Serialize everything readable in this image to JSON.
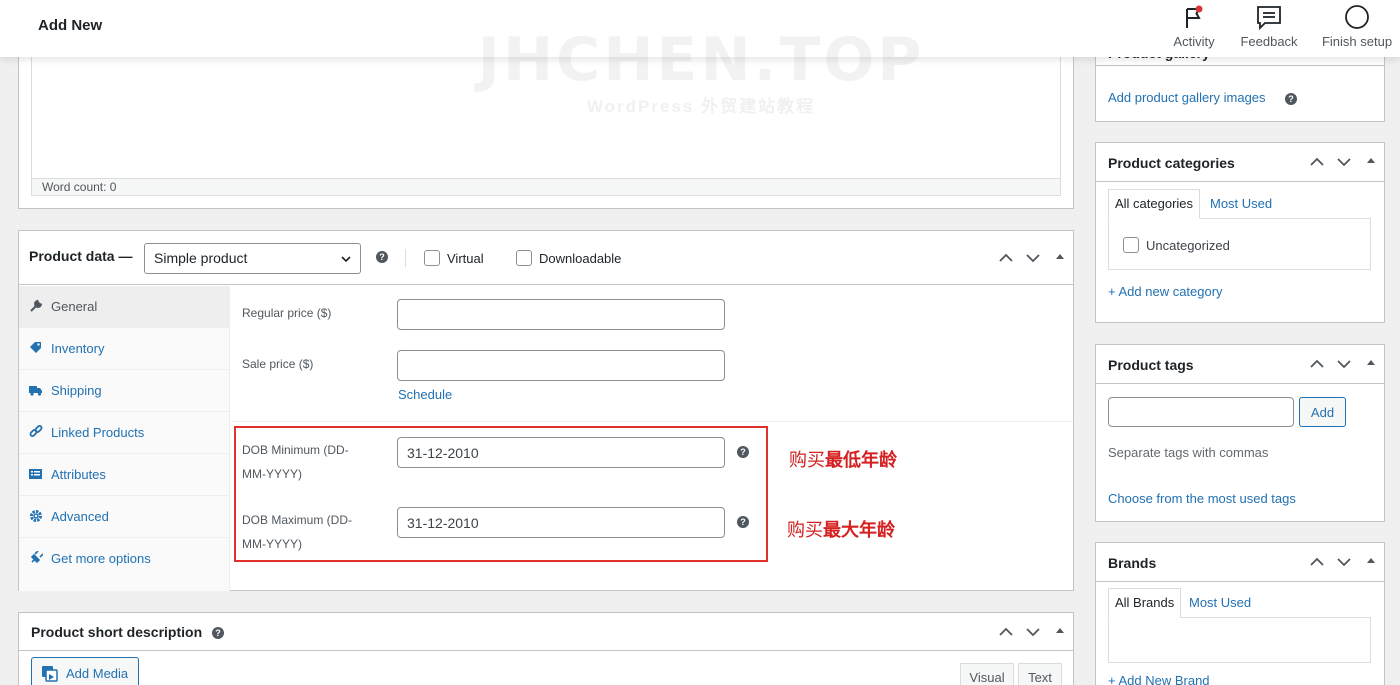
{
  "topbar": {
    "title": "Add New",
    "actions": [
      {
        "label": "Activity",
        "icon": "flag-icon"
      },
      {
        "label": "Feedback",
        "icon": "feedback-icon"
      },
      {
        "label": "Finish setup",
        "icon": "circle-icon"
      }
    ]
  },
  "watermark": {
    "big": "JHCHEN.TOP",
    "small": "WordPress 外贸建站教程"
  },
  "editor": {
    "word_count": "Word count: 0"
  },
  "product_data": {
    "label": "Product data —",
    "type_select": "Simple product",
    "virtual_label": "Virtual",
    "downloadable_label": "Downloadable",
    "tabs": [
      {
        "label": "General",
        "icon": "wrench-icon",
        "active": true
      },
      {
        "label": "Inventory",
        "icon": "tag-icon"
      },
      {
        "label": "Shipping",
        "icon": "truck-icon"
      },
      {
        "label": "Linked Products",
        "icon": "link-icon"
      },
      {
        "label": "Attributes",
        "icon": "list-icon"
      },
      {
        "label": "Advanced",
        "icon": "gear-icon"
      },
      {
        "label": "Get more options",
        "icon": "plugin-icon"
      }
    ],
    "regular_price_label": "Regular price ($)",
    "regular_price_value": "",
    "sale_price_label": "Sale price ($)",
    "sale_price_value": "",
    "schedule_link": "Schedule",
    "dob_min_label_1": "DOB Minimum (DD-",
    "dob_min_label_2": "MM-YYYY)",
    "dob_min_value": "31-12-2010",
    "dob_max_label_1": "DOB Maximum (DD-",
    "dob_max_label_2": "MM-YYYY)",
    "dob_max_value": "31-12-2010"
  },
  "annotations": {
    "min_prefix": "购买",
    "min_bold": "最低年龄",
    "max_prefix": "购买",
    "max_bold": "最大年龄"
  },
  "short_description": {
    "label": "Product short description",
    "add_media": "Add Media",
    "visual_tab": "Visual",
    "text_tab": "Text"
  },
  "gallery": {
    "title": "Product gallery",
    "link": "Add product gallery images"
  },
  "categories": {
    "title": "Product categories",
    "tab_all": "All categories",
    "tab_most_used": "Most Used",
    "items": [
      {
        "label": "Uncategorized",
        "checked": false
      }
    ],
    "add_link": "+ Add new category"
  },
  "tags": {
    "title": "Product tags",
    "input_value": "",
    "add_button": "Add",
    "hint": "Separate tags with commas",
    "choose_link": "Choose from the most used tags"
  },
  "brands": {
    "title": "Brands",
    "tab_all": "All Brands",
    "tab_most_used": "Most Used",
    "add_link": "+ Add New Brand"
  },
  "colors": {
    "accent": "#2271b1",
    "highlight_red": "#e0322c",
    "text": "#1d2327"
  }
}
